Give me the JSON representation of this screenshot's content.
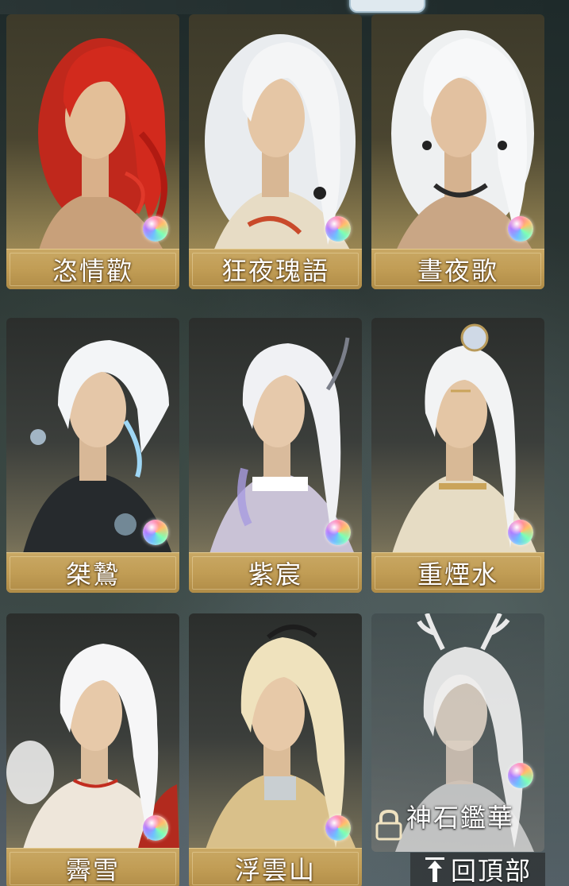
{
  "characters": [
    {
      "name": "恣情歡",
      "hair": "red"
    },
    {
      "name": "狂夜瑰語",
      "hair": "white"
    },
    {
      "name": "晝夜歌",
      "hair": "white"
    },
    {
      "name": "桀鷙",
      "hair": "white"
    },
    {
      "name": "紫宸",
      "hair": "white"
    },
    {
      "name": "重煙水",
      "hair": "white"
    },
    {
      "name": "霽雪",
      "hair": "white"
    },
    {
      "name": "浮雲山",
      "hair": "blonde"
    },
    {
      "name": "神石鑑華",
      "hair": "white",
      "locked": true
    }
  ],
  "colors": {
    "name_plate": "#c19d55",
    "orb_accent": "#b07cff"
  },
  "icons": {
    "orb": "rainbow-orb-icon",
    "lock": "lock-icon",
    "arrow": "arrow-up-icon"
  },
  "back_to_top_label": "回頂部"
}
